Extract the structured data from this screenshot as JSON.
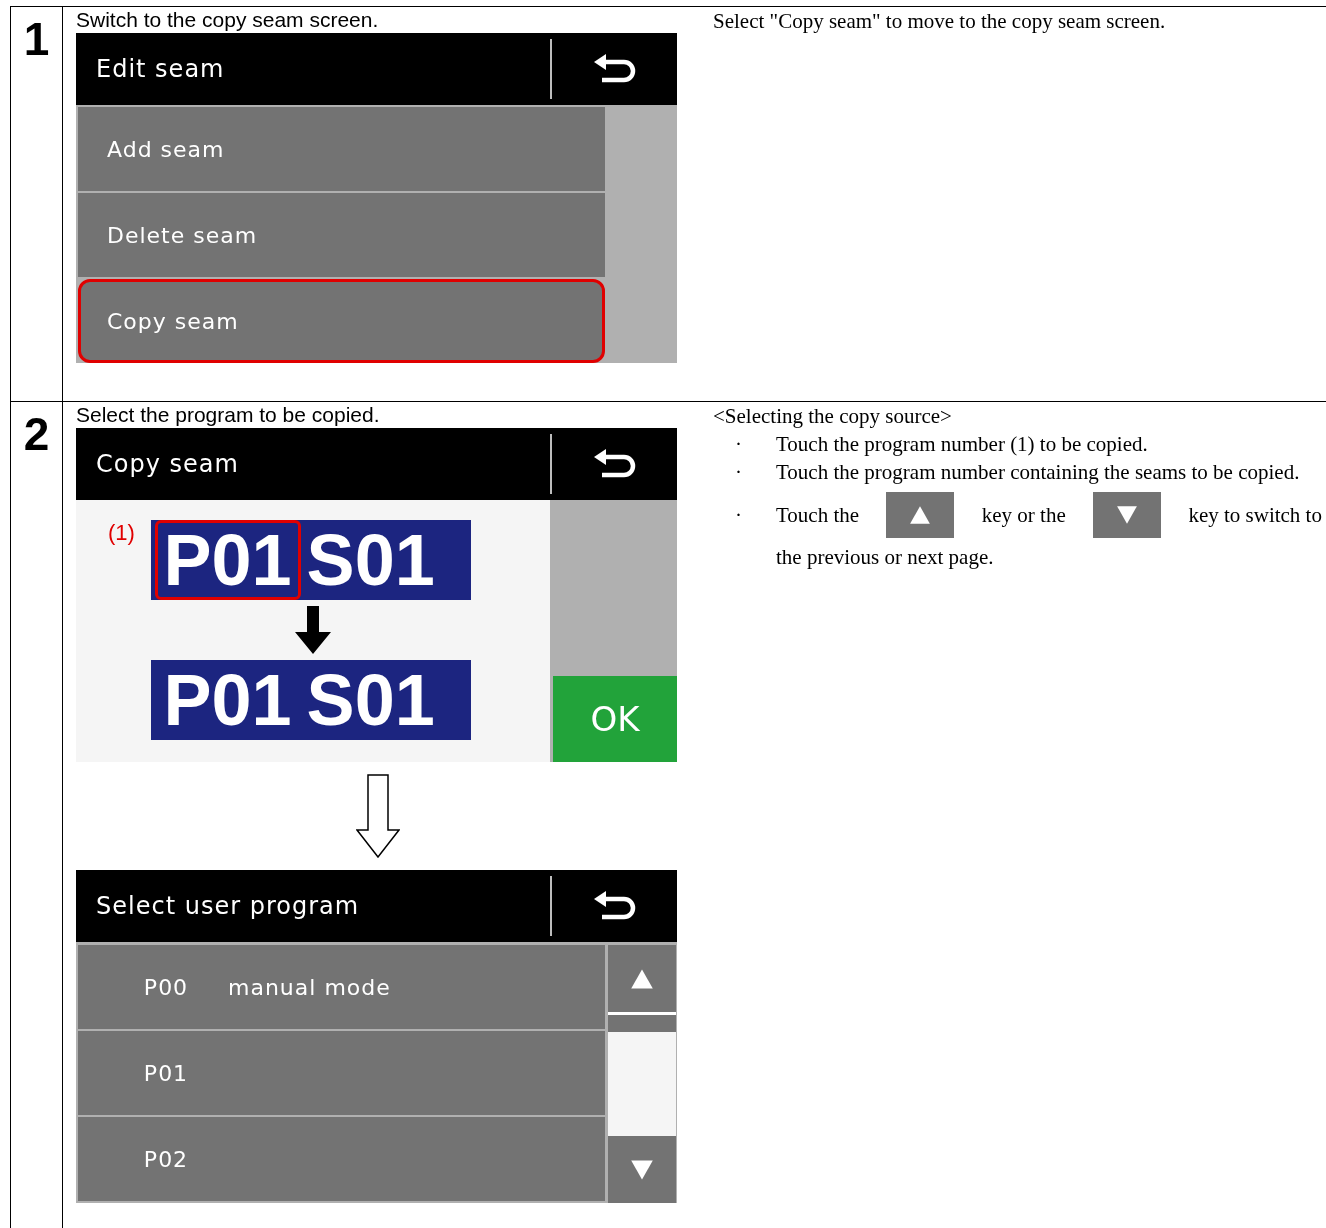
{
  "steps": [
    {
      "number": "1",
      "caption": "Switch to the copy seam screen.",
      "screens": [
        {
          "kind": "menu",
          "title": "Edit seam",
          "items": [
            {
              "label": "Add seam",
              "highlighted": false
            },
            {
              "label": "Delete seam",
              "highlighted": false
            },
            {
              "label": "Copy seam",
              "highlighted": true
            }
          ]
        }
      ],
      "description": [
        {
          "kind": "para",
          "text": "Select \"Copy seam\" to move to the copy seam screen."
        }
      ]
    },
    {
      "number": "2",
      "caption": "Select the program to be copied.",
      "screens": [
        {
          "kind": "copy",
          "title": "Copy seam",
          "callout": "(1)",
          "source": {
            "program": "P01",
            "seam": "S01",
            "program_highlighted": true
          },
          "target": {
            "program": "P01",
            "seam": "S01"
          },
          "ok": "OK"
        },
        {
          "kind": "arrow"
        },
        {
          "kind": "list",
          "title": "Select user program",
          "items": [
            {
              "code": "P00",
              "name": "manual mode"
            },
            {
              "code": "P01"
            },
            {
              "code": "P02"
            }
          ]
        }
      ],
      "description": [
        {
          "kind": "heading",
          "text": "<Selecting the copy source>"
        },
        {
          "kind": "bullet",
          "mark": "·",
          "text": "Touch the program number (1) to be copied."
        },
        {
          "kind": "bullet",
          "mark": "·",
          "text": "Touch the program number containing the seams to be copied."
        },
        {
          "kind": "keys",
          "mark": "·",
          "parts": [
            "Touch the",
            "key or the",
            "key to switch to",
            "the previous or next page."
          ]
        }
      ]
    }
  ]
}
